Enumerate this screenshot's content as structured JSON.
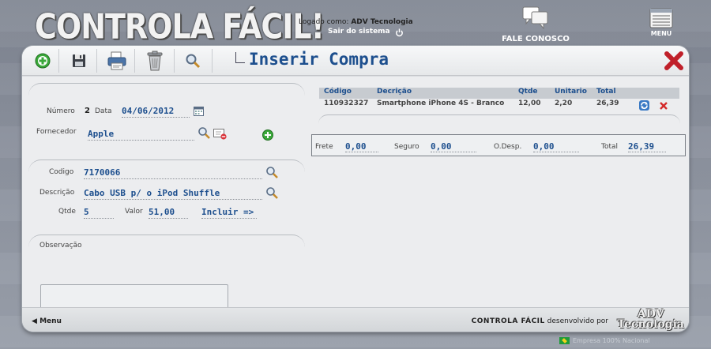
{
  "header": {
    "brand": "CONTROLA FÁCIL!",
    "logged_label": "Logado como:",
    "logged_company": "ADV Tecnologia",
    "logout": "Sair do sistema",
    "contact": "FALE CONOSCO",
    "menu": "MENU"
  },
  "page": {
    "title": "Inserir Compra",
    "accent_color": "#1d4f8e",
    "close_color": "#c0202a"
  },
  "toolbar": {
    "icons": [
      "add-icon",
      "save-icon",
      "print-icon",
      "trash-icon",
      "search-icon"
    ]
  },
  "header_section": {
    "numero_label": "Número",
    "numero_value": "2",
    "data_label": "Data",
    "data_value": "04/06/2012",
    "fornecedor_label": "Fornecedor",
    "fornecedor_value": "Apple"
  },
  "item_section": {
    "codigo_label": "Codigo",
    "codigo_value": "7170066",
    "descricao_label": "Descrição",
    "descricao_value": "Cabo USB p/ o iPod Shuffle",
    "qtde_label": "Qtde",
    "qtde_value": "5",
    "valor_label": "Valor",
    "valor_value": "51,00",
    "incluir_label": "Incluir =>"
  },
  "obs_section": {
    "label": "Observação",
    "value": ""
  },
  "grid": {
    "columns": [
      "Código",
      "Decrição",
      "Qtde",
      "Unitario",
      "Total"
    ],
    "rows": [
      {
        "codigo": "110932327",
        "descricao": "Smartphone iPhone 4S - Branco",
        "qtde": "12,00",
        "unitario": "2,20",
        "total": "26,39"
      }
    ]
  },
  "totals": {
    "frete_label": "Frete",
    "frete_value": "0,00",
    "seguro_label": "Seguro",
    "seguro_value": "0,00",
    "odesp_label": "O.Desp.",
    "odesp_value": "0,00",
    "total_label": "Total",
    "total_value": "26,39"
  },
  "footer": {
    "menu": "Menu",
    "product": "CONTROLA FÁCIL",
    "credit": "desenvolvido por",
    "logo_line1": "ADV",
    "logo_line2": "Tecnologia"
  },
  "status": {
    "text": "Empresa 100% Nacional"
  }
}
